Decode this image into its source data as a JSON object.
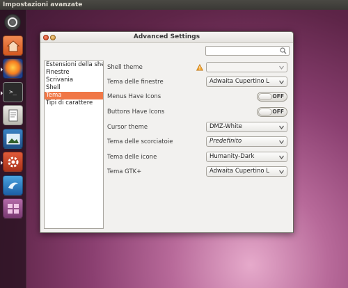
{
  "panel": {
    "title": "Impostazioni avanzate"
  },
  "launcher": {
    "items": [
      {
        "name": "dash-home-icon"
      },
      {
        "name": "home-folder-icon"
      },
      {
        "name": "firefox-icon"
      },
      {
        "name": "terminal-icon"
      },
      {
        "name": "text-editor-icon"
      },
      {
        "name": "image-viewer-icon"
      },
      {
        "name": "system-settings-icon"
      },
      {
        "name": "thunderbird-icon"
      },
      {
        "name": "workspace-switcher-icon"
      }
    ]
  },
  "window": {
    "title": "Advanced Settings"
  },
  "search": {
    "placeholder": ""
  },
  "sidebar": {
    "items": [
      {
        "label": "Estensioni della shell"
      },
      {
        "label": "Finestre"
      },
      {
        "label": "Scrivania"
      },
      {
        "label": "Shell"
      },
      {
        "label": "Tema"
      },
      {
        "label": "Tipi di carattere"
      }
    ],
    "selected": "Tema"
  },
  "settings": {
    "shell_theme": {
      "label": "Shell theme",
      "value": ""
    },
    "window_theme": {
      "label": "Tema delle finestre",
      "value": "Adwaita Cupertino L"
    },
    "menus_have_icons": {
      "label": "Menus Have Icons",
      "state": "OFF"
    },
    "buttons_have_icons": {
      "label": "Buttons Have Icons",
      "state": "OFF"
    },
    "cursor_theme": {
      "label": "Cursor theme",
      "value": "DMZ-White"
    },
    "keybinding_theme": {
      "label": "Tema delle scorciatoie",
      "value": "Predefinito"
    },
    "icon_theme": {
      "label": "Tema delle icone",
      "value": "Humanity-Dark"
    },
    "gtk_theme": {
      "label": "Tema GTK+",
      "value": "Adwaita Cupertino L"
    }
  },
  "colors": {
    "selection": "#f07746",
    "warning": "#f0a22c"
  }
}
